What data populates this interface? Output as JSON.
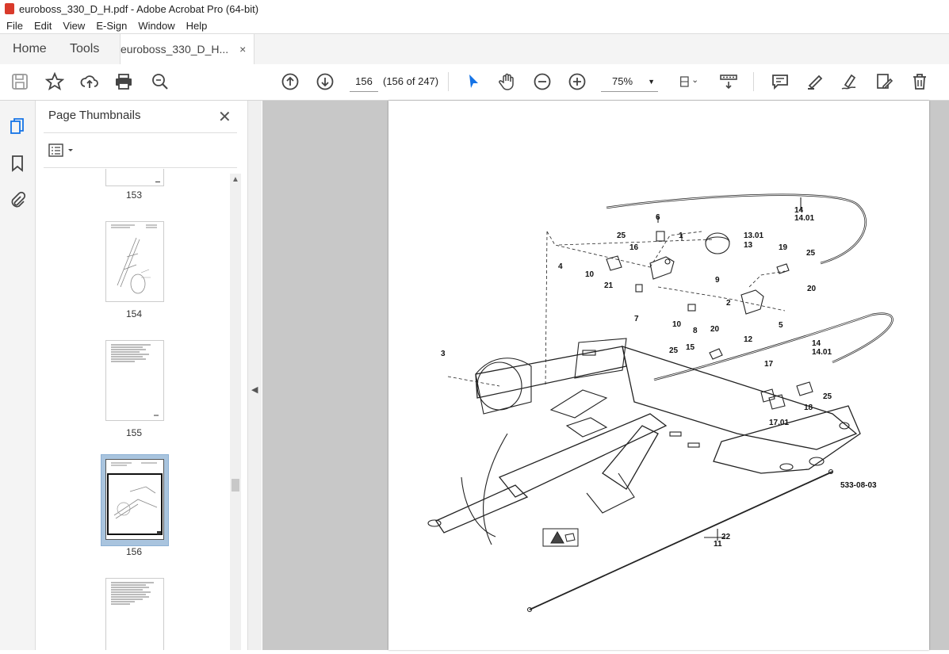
{
  "window": {
    "title": "euroboss_330_D_H.pdf - Adobe Acrobat Pro (64-bit)"
  },
  "menu": [
    "File",
    "Edit",
    "View",
    "E-Sign",
    "Window",
    "Help"
  ],
  "tabs": {
    "home": "Home",
    "tools": "Tools",
    "document": "euroboss_330_D_H...",
    "close": "×"
  },
  "toolbar": {
    "page_input": "156",
    "page_count": "(156 of 247)",
    "zoom": "75%",
    "icons": [
      "save-icon",
      "star-icon",
      "upload-icon",
      "print-icon",
      "zoom-search-icon",
      "page-up-icon",
      "page-down-icon",
      "select-cursor-icon",
      "hand-icon",
      "zoom-out-icon",
      "zoom-in-icon",
      "page-fit-icon",
      "scroll-mode-icon",
      "comment-icon",
      "highlight-icon",
      "sign-icon",
      "edit-pdf-icon",
      "delete-icon"
    ]
  },
  "sidebar": {
    "title": "Page Thumbnails",
    "close": "✕",
    "thumbnails": [
      {
        "label": "153"
      },
      {
        "label": "154"
      },
      {
        "label": "155"
      },
      {
        "label": "156",
        "selected": true
      },
      {
        "label": ""
      }
    ]
  },
  "drawing": {
    "code": "533-08-03",
    "callouts": [
      "1",
      "2",
      "3",
      "4",
      "5",
      "6",
      "7",
      "8",
      "9",
      "10",
      "10",
      "11",
      "12",
      "13.01",
      "13",
      "14",
      "14.01",
      "14",
      "14.01",
      "15",
      "16",
      "17",
      "17.01",
      "18",
      "19",
      "20",
      "20",
      "21",
      "22",
      "25",
      "25",
      "25",
      "25"
    ]
  }
}
